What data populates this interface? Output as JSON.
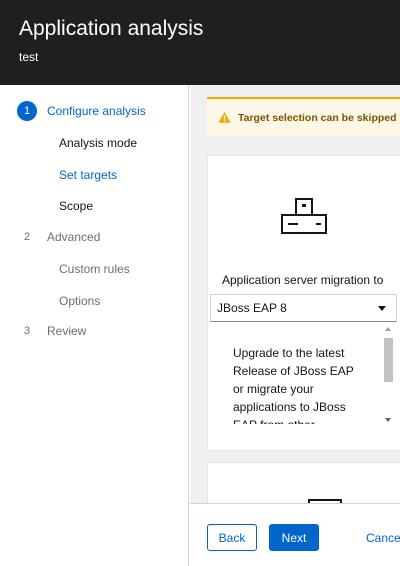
{
  "header": {
    "title": "Application analysis",
    "subtitle": "test"
  },
  "nav": {
    "steps": [
      {
        "number": "1",
        "label": "Configure analysis"
      },
      {
        "number": "2",
        "label": "Advanced"
      },
      {
        "number": "3",
        "label": "Review"
      }
    ],
    "sub_items": [
      {
        "label": "Analysis mode"
      },
      {
        "label": "Set targets"
      },
      {
        "label": "Scope"
      },
      {
        "label": "Custom rules"
      },
      {
        "label": "Options"
      }
    ]
  },
  "alert": {
    "text": "Target selection can be skipped i",
    "icon": "warning-icon",
    "color": "#f0ab00"
  },
  "target_card": {
    "icon": "server-icon",
    "title": "Application server migration to",
    "select_value": "JBoss EAP 8",
    "description": "Upgrade to the latest Release of JBoss EAP or migrate your applications to JBoss EAP from other"
  },
  "footer": {
    "back_label": "Back",
    "next_label": "Next",
    "cancel_label": "Cance"
  },
  "colors": {
    "accent": "#0066cc",
    "header_bg": "#1f1f1f",
    "warning": "#f0ab00"
  }
}
